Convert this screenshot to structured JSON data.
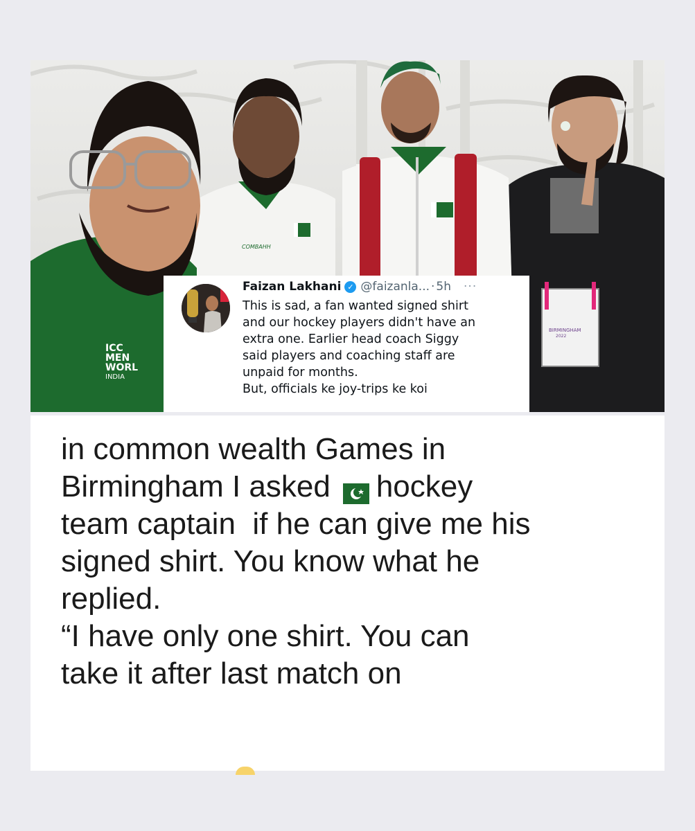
{
  "tweet": {
    "name": "Faizan Lakhani",
    "handle": "@faizanla...",
    "separator": "·",
    "time": "5h",
    "more": "···",
    "lines": [
      "This is sad, a fan wanted signed shirt",
      "and our hockey players didn't have an",
      "extra one. Earlier head coach Siggy",
      "said players and coaching staff are",
      "unpaid for months.",
      "But, officials ke joy-trips ke koi"
    ]
  },
  "photo": {
    "jersey_brand": "COMBAHH",
    "jersey_text_left": [
      "ICC",
      "MEN",
      "WORL",
      "INDIA"
    ],
    "badge_text": [
      "BIRMINGHAM",
      "2022"
    ]
  },
  "caption": {
    "lines": [
      "in common wealth Games in",
      "Birmingham I asked",
      "hockey",
      "team captain  if he can give me his",
      "signed shirt. You know what he",
      "replied.",
      "“I have only one shirt. You can",
      "take it after last match on"
    ],
    "flag_icon": "pakistan-flag-icon"
  },
  "colors": {
    "background": "#ebebf0",
    "jersey_green": "#1d6b2e",
    "verified_blue": "#1d9bf0"
  }
}
